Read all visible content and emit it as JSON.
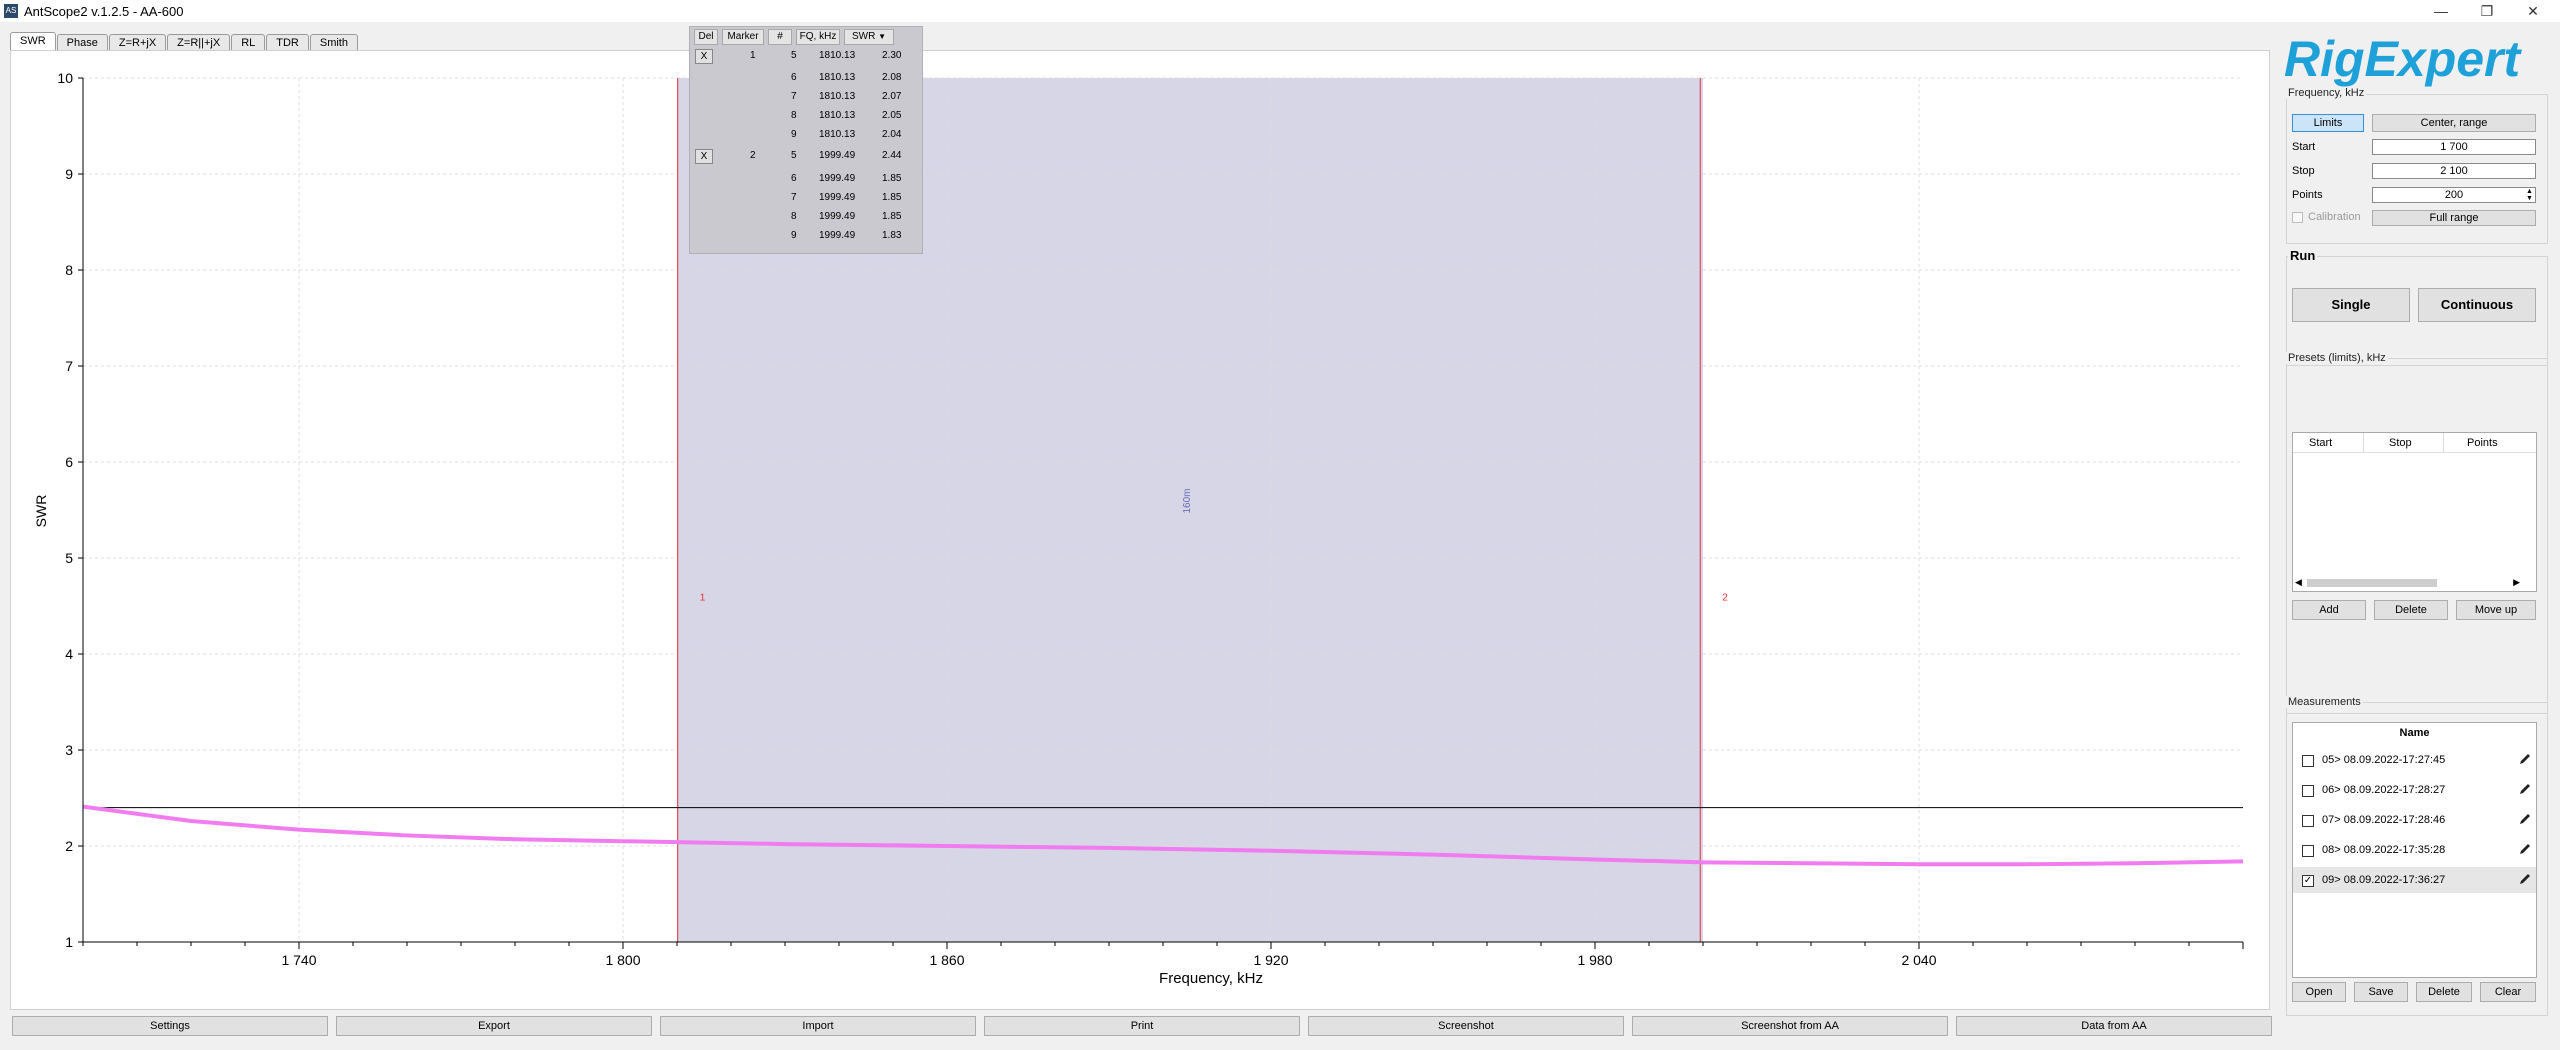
{
  "window": {
    "title": "AntScope2 v.1.2.5 - AA-600",
    "minimize_glyph": "—",
    "maximize_glyph": "❐",
    "close_glyph": "✕"
  },
  "tabs": [
    "SWR",
    "Phase",
    "Z=R+jX",
    "Z=R||+jX",
    "RL",
    "TDR",
    "Smith"
  ],
  "marker_table": {
    "headers": {
      "del": "Del",
      "marker": "Marker",
      "num": "#",
      "fq": "FQ, kHz",
      "swr": "SWR"
    },
    "rows": [
      {
        "del": "X",
        "marker": "1",
        "num": "5",
        "fq": "1810.13",
        "swr": "2.30"
      },
      {
        "del": "",
        "marker": "",
        "num": "6",
        "fq": "1810.13",
        "swr": "2.08"
      },
      {
        "del": "",
        "marker": "",
        "num": "7",
        "fq": "1810.13",
        "swr": "2.07"
      },
      {
        "del": "",
        "marker": "",
        "num": "8",
        "fq": "1810.13",
        "swr": "2.05"
      },
      {
        "del": "",
        "marker": "",
        "num": "9",
        "fq": "1810.13",
        "swr": "2.04"
      },
      {
        "del": "X",
        "marker": "2",
        "num": "5",
        "fq": "1999.49",
        "swr": "2.44"
      },
      {
        "del": "",
        "marker": "",
        "num": "6",
        "fq": "1999.49",
        "swr": "1.85"
      },
      {
        "del": "",
        "marker": "",
        "num": "7",
        "fq": "1999.49",
        "swr": "1.85"
      },
      {
        "del": "",
        "marker": "",
        "num": "8",
        "fq": "1999.49",
        "swr": "1.85"
      },
      {
        "del": "",
        "marker": "",
        "num": "9",
        "fq": "1999.49",
        "swr": "1.83"
      }
    ]
  },
  "chart_data": {
    "type": "line",
    "xlabel": "Frequency, kHz",
    "ylabel": "SWR",
    "xlim": [
      1700,
      2100
    ],
    "ylim": [
      1,
      10
    ],
    "x_ticks": [
      1740,
      1800,
      1860,
      1920,
      1980,
      2040
    ],
    "x_tick_labels": [
      "1 740",
      "1 800",
      "1 860",
      "1 920",
      "1 980",
      "2 040"
    ],
    "y_ticks": [
      1,
      2,
      3,
      4,
      5,
      6,
      7,
      8,
      9,
      10
    ],
    "y_tick_labels": [
      "1",
      "2",
      "3",
      "4",
      "5",
      "6",
      "7",
      "8",
      "9",
      "10"
    ],
    "grid": true,
    "band": {
      "label": "160m",
      "start": 1810,
      "stop": 2000,
      "color": "#d6d6e6"
    },
    "markers": [
      {
        "label": "1",
        "x": 1810.13
      },
      {
        "label": "2",
        "x": 1999.49
      }
    ],
    "reference_line": {
      "y": 2.4,
      "color": "#000000"
    },
    "series": [
      {
        "color": "#f07cf0",
        "x": [
          1700,
          1720,
          1740,
          1760,
          1780,
          1800,
          1810,
          1830,
          1860,
          1890,
          1920,
          1950,
          1980,
          2000,
          2020,
          2040,
          2060,
          2080,
          2100
        ],
        "y": [
          2.41,
          2.26,
          2.17,
          2.11,
          2.07,
          2.05,
          2.04,
          2.02,
          2.0,
          1.98,
          1.95,
          1.91,
          1.86,
          1.83,
          1.82,
          1.81,
          1.81,
          1.82,
          1.84
        ]
      }
    ]
  },
  "right_panel": {
    "logo_text": "RigExpert",
    "frequency_group_title": "Frequency, kHz",
    "limits_label": "Limits",
    "center_range_label": "Center, range",
    "start_label": "Start",
    "start_value": "1 700",
    "stop_label": "Stop",
    "stop_value": "2 100",
    "points_label": "Points",
    "points_value": "200",
    "calibration_label": "Calibration",
    "full_range_label": "Full range",
    "run_title": "Run",
    "single_label": "Single",
    "continuous_label": "Continuous",
    "presets_title": "Presets (limits), kHz",
    "presets_columns": [
      "Start",
      "Stop",
      "Points"
    ],
    "add_label": "Add",
    "delete_label": "Delete",
    "move_up_label": "Move up",
    "measurements_title": "Measurements",
    "measurements_column": "Name",
    "measurements": [
      {
        "name": "05> 08.09.2022-17:27:45",
        "checked": false
      },
      {
        "name": "06> 08.09.2022-17:28:27",
        "checked": false
      },
      {
        "name": "07> 08.09.2022-17:28:46",
        "checked": false
      },
      {
        "name": "08> 08.09.2022-17:35:28",
        "checked": false
      },
      {
        "name": "09> 08.09.2022-17:36:27",
        "checked": true
      }
    ],
    "open_label": "Open",
    "save_label": "Save",
    "mdelete_label": "Delete",
    "clear_label": "Clear"
  },
  "bottom_bar": [
    "Settings",
    "Export",
    "Import",
    "Print",
    "Screenshot",
    "Screenshot from AA",
    "Data from AA"
  ]
}
